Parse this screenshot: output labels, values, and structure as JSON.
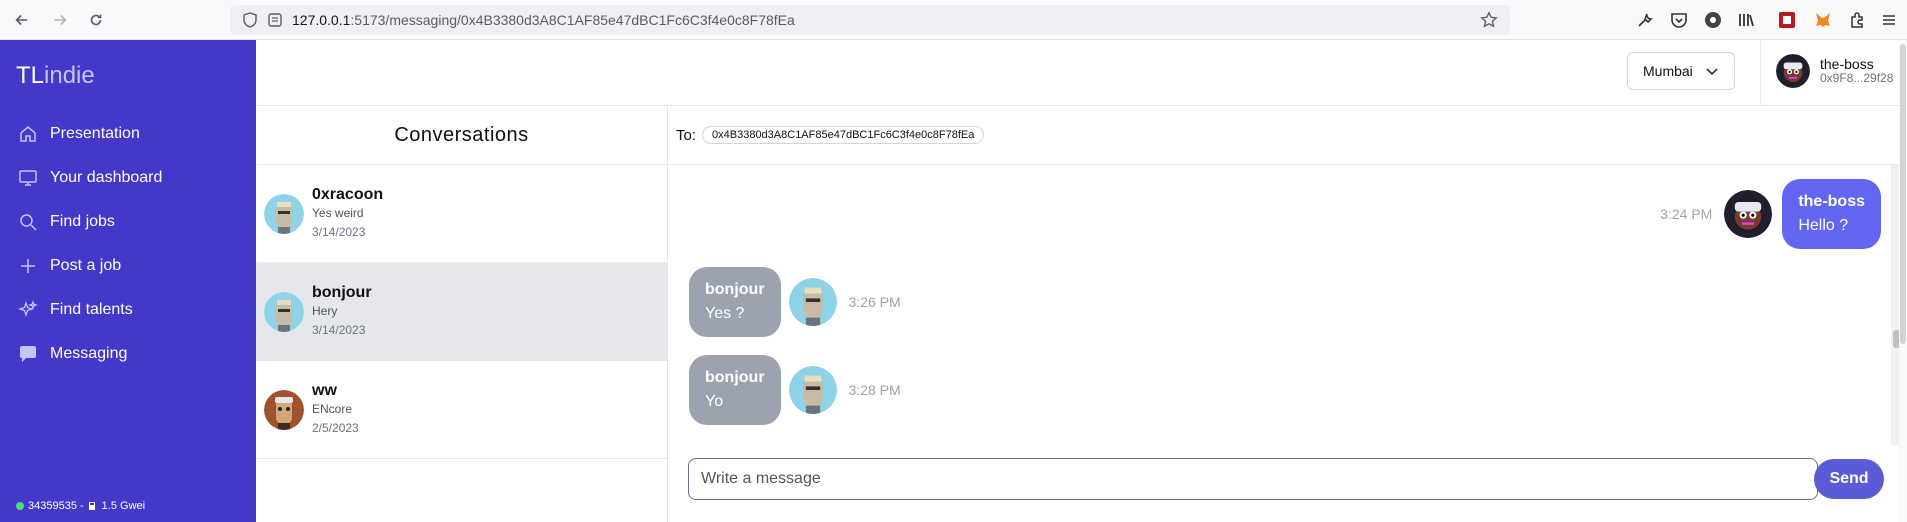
{
  "browser": {
    "url_host": "127.0.0.1",
    "url_rest": ":5173/messaging/0x4B3380d3A8C1AF85e47dBC1Fc6C3f4e0c8F78fEa"
  },
  "sidebar": {
    "brand_tl": "TL",
    "brand_indie": "indie",
    "items": [
      {
        "label": "Presentation",
        "icon": "home-icon"
      },
      {
        "label": "Your dashboard",
        "icon": "dashboard-icon"
      },
      {
        "label": "Find jobs",
        "icon": "search-icon"
      },
      {
        "label": "Post a job",
        "icon": "plus-icon"
      },
      {
        "label": "Find talents",
        "icon": "sparkles-icon"
      },
      {
        "label": "Messaging",
        "icon": "chat-bubble-icon"
      }
    ],
    "footer": {
      "block": "34359535 -",
      "gas": "1.5 Gwei"
    }
  },
  "header": {
    "network": "Mumbai",
    "user_name": "the-boss",
    "user_address": "0x9F8...29f28"
  },
  "conversations": {
    "title": "Conversations",
    "items": [
      {
        "name": "0xracoon",
        "last": "Yes weird",
        "date": "3/14/2023"
      },
      {
        "name": "bonjour",
        "last": "Hery",
        "date": "3/14/2023"
      },
      {
        "name": "ww",
        "last": "ENcore",
        "date": "2/5/2023"
      }
    ]
  },
  "chat": {
    "to_label": "To:",
    "to_address": "0x4B3380d3A8C1AF85e47dBC1Fc6C3f4e0c8F78fEa",
    "messages": [
      {
        "sender": "the-boss",
        "text": "Hello ?",
        "time": "3:24 PM",
        "mine": true
      },
      {
        "sender": "bonjour",
        "text": "Yes ?",
        "time": "3:26 PM",
        "mine": false
      },
      {
        "sender": "bonjour",
        "text": "Yo",
        "time": "3:28 PM",
        "mine": false
      }
    ],
    "compose_placeholder": "Write a message",
    "send_label": "Send"
  },
  "colors": {
    "sidebar": "#4338ca",
    "own_bubble": "#6366f1",
    "other_bubble": "#9ca3af",
    "send_button": "#5b5bd6"
  }
}
